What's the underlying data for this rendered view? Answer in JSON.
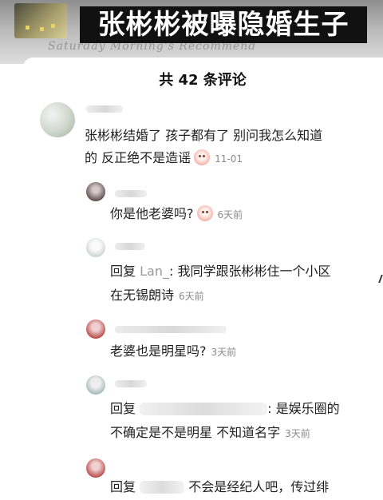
{
  "headline": "张彬彬被曝隐婚生子",
  "sheet_title": "共 42 条评论",
  "background_script": "Saturday Morning's Recommend",
  "comments": [
    {
      "text_line1": "张彬彬结婚了 孩子都有了 别问我怎么知道",
      "text_line2": "的 反正绝不是造谣",
      "emoji": "smile-emoji",
      "time": "11-01"
    },
    {
      "text": "你是他老婆吗?",
      "emoji": "smile-emoji",
      "time": "6天前"
    },
    {
      "reply_label": "回复",
      "reply_to": "Lan_",
      "text_line1": ": 我同学跟张彬彬住一个小区",
      "text_line2": "在无锡朗诗",
      "time": "6天前"
    },
    {
      "text": "老婆也是明星吗?",
      "time": "3天前"
    },
    {
      "reply_label": "回复",
      "text_line1": ": 是娱乐圈的",
      "text_line2": "不确定是不是明星 不知道名字",
      "time": "3天前"
    },
    {
      "reply_label": "回复",
      "text_line1": "不会是经纪人吧，传过绯"
    }
  ]
}
